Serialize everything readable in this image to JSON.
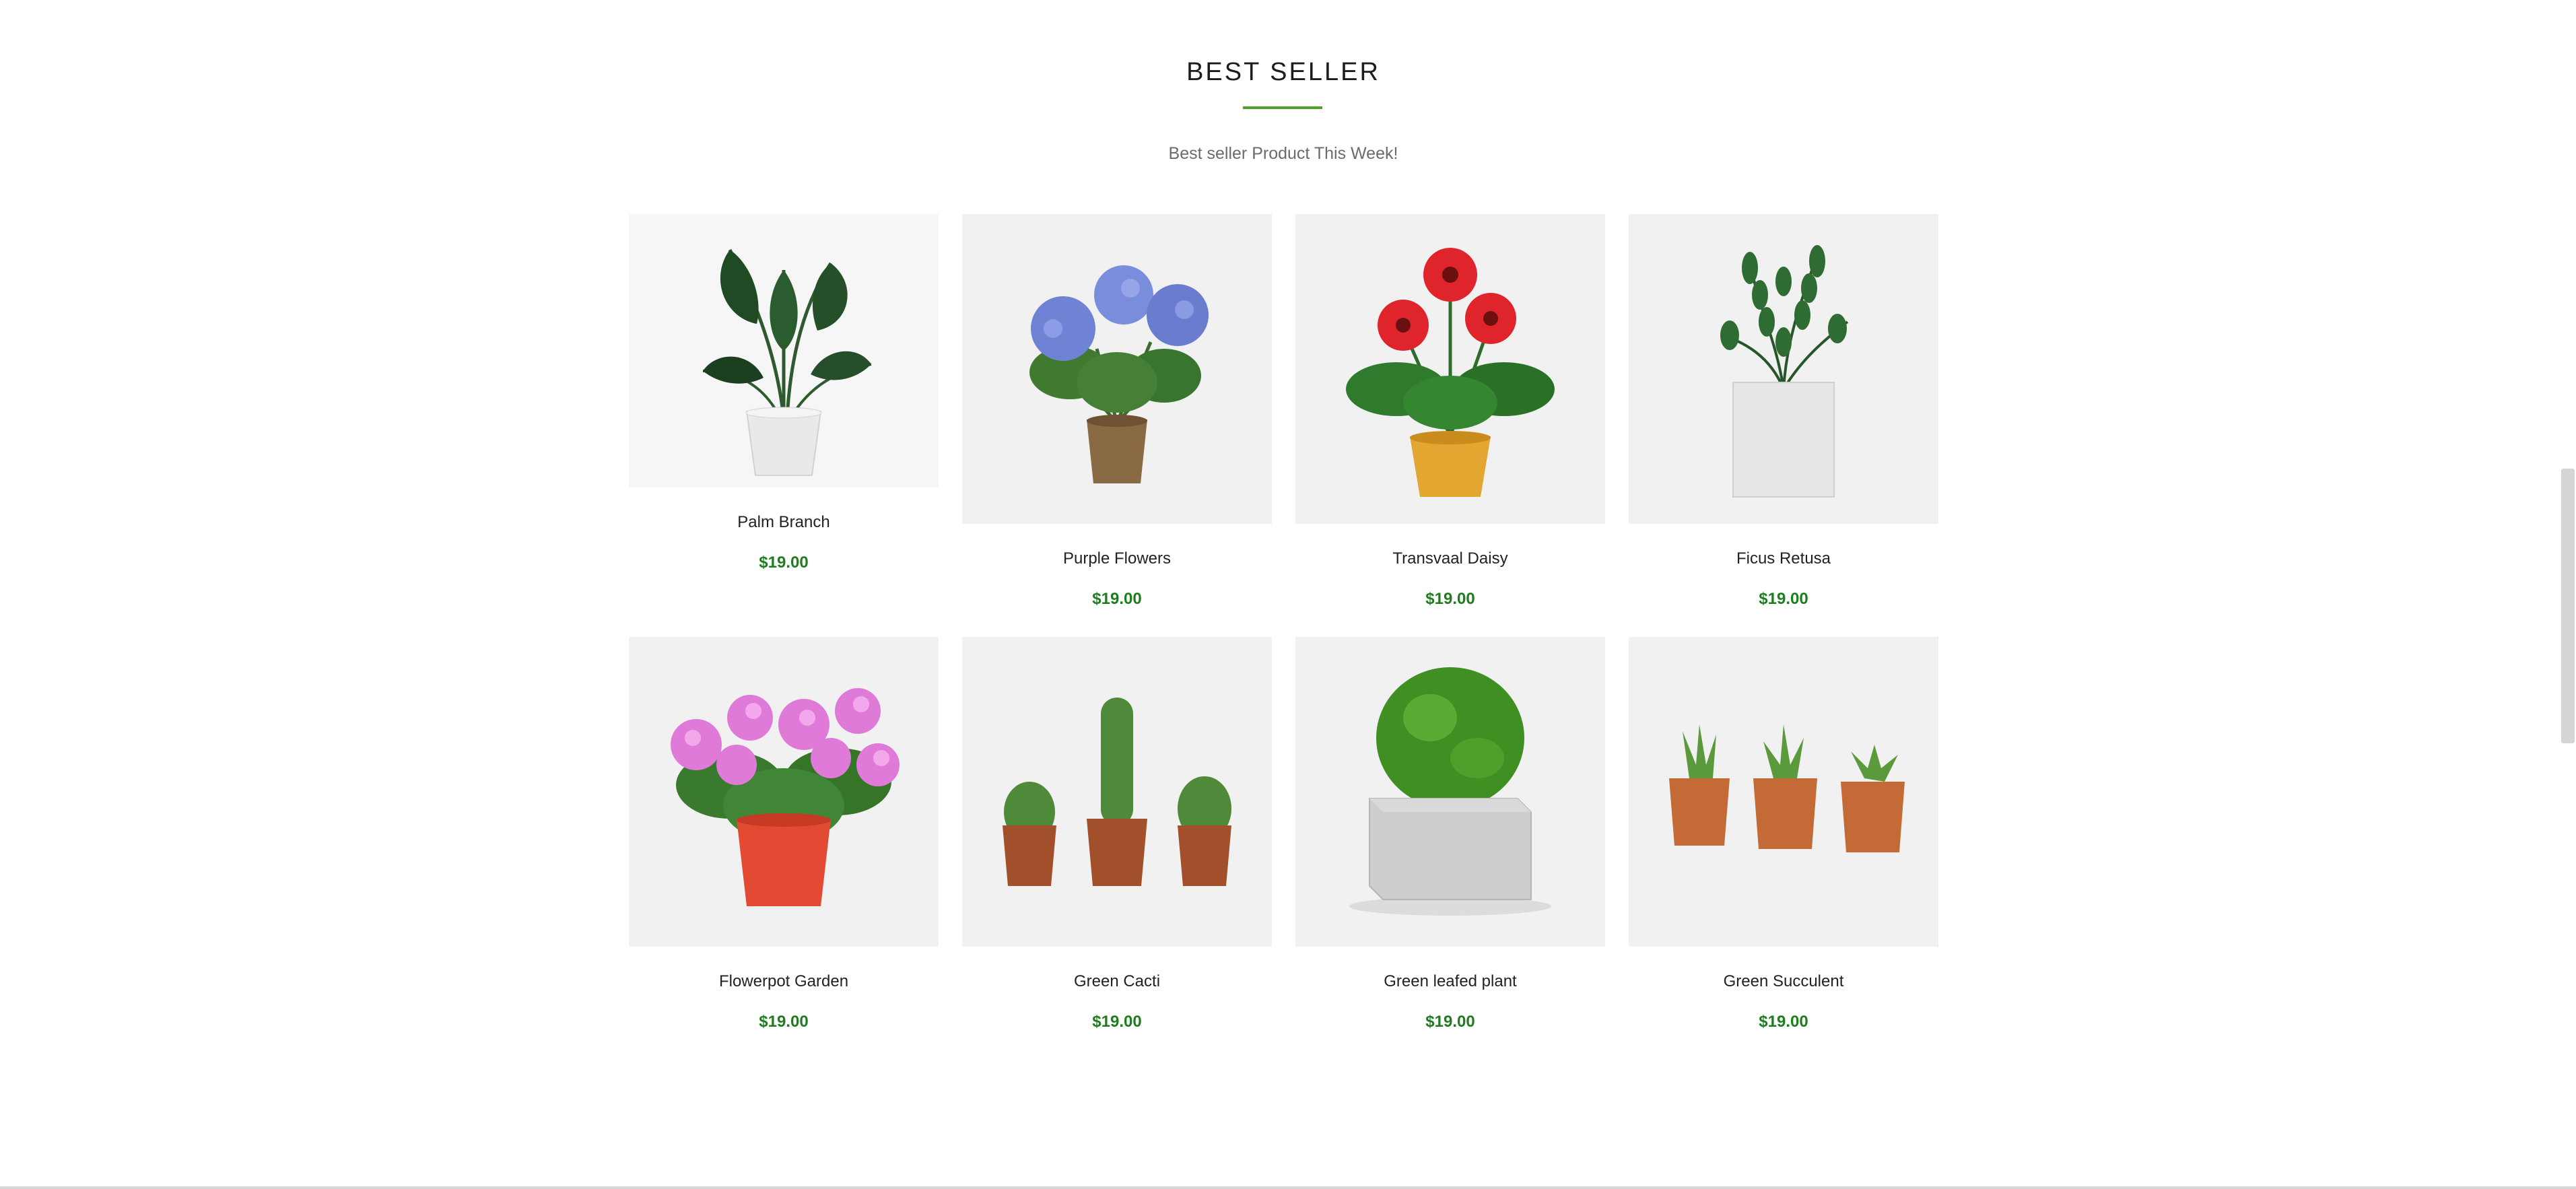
{
  "section": {
    "title": "BEST SELLER",
    "subtitle": "Best seller Product This Week!",
    "accent_color": "#4f9f2a",
    "price_color": "#1e7d1e"
  },
  "products": [
    {
      "name": "Palm Branch",
      "price": "$19.00",
      "icon": "palm-plant-icon"
    },
    {
      "name": "Purple Flowers",
      "price": "$19.00",
      "icon": "hydrangea-icon"
    },
    {
      "name": "Transvaal Daisy",
      "price": "$19.00",
      "icon": "daisy-icon"
    },
    {
      "name": "Ficus Retusa",
      "price": "$19.00",
      "icon": "ficus-icon"
    },
    {
      "name": "Flowerpot Garden",
      "price": "$19.00",
      "icon": "pink-flowers-icon"
    },
    {
      "name": "Green Cacti",
      "price": "$19.00",
      "icon": "cacti-icon"
    },
    {
      "name": "Green leafed plant",
      "price": "$19.00",
      "icon": "bush-icon"
    },
    {
      "name": "Green Succulent",
      "price": "$19.00",
      "icon": "succulents-icon"
    }
  ]
}
